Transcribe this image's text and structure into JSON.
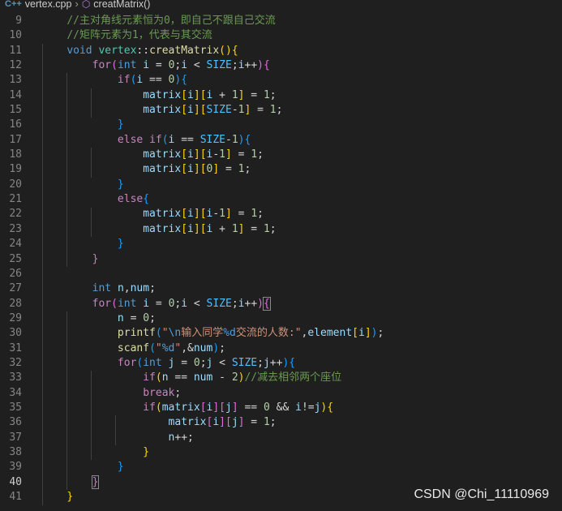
{
  "breadcrumb": {
    "file_icon": "C++",
    "file": "vertex.cpp",
    "separator": "›",
    "method_icon": "⬡",
    "method": "creatMatrix()"
  },
  "watermark": "CSDN @Chi_11110969",
  "colors": {
    "background": "#1f1f1f",
    "comment": "#6a9955",
    "keyword": "#569cd6",
    "control": "#c586c0",
    "function": "#dcdcaa",
    "type": "#4ec9b0",
    "variable": "#9cdcfe",
    "constant": "#4fc1ff",
    "number": "#b5cea8",
    "string": "#ce9178",
    "bracket1": "#ffd700",
    "bracket2": "#da70d6",
    "bracket3": "#179fff"
  },
  "lines": [
    {
      "n": "9",
      "tokens": [
        [
          "    ",
          ""
        ],
        [
          "//主对角线元素恒为0，即自己不跟自己交流",
          "com"
        ]
      ]
    },
    {
      "n": "10",
      "tokens": [
        [
          "    ",
          ""
        ],
        [
          "//矩阵元素为1，代表与其交流",
          "com"
        ]
      ]
    },
    {
      "n": "11",
      "tokens": [
        [
          "    ",
          ""
        ],
        [
          "void",
          "kw"
        ],
        [
          " ",
          ""
        ],
        [
          "vertex",
          "ty"
        ],
        [
          "::",
          "op"
        ],
        [
          "creatMatrix",
          "fn"
        ],
        [
          "(",
          "p1"
        ],
        [
          ")",
          "p1"
        ],
        [
          "{",
          "p1"
        ]
      ]
    },
    {
      "n": "12",
      "tokens": [
        [
          "        ",
          ""
        ],
        [
          "for",
          "ctl"
        ],
        [
          "(",
          "p2"
        ],
        [
          "int",
          "kw"
        ],
        [
          " ",
          ""
        ],
        [
          "i",
          "var"
        ],
        [
          " = ",
          "op"
        ],
        [
          "0",
          "num"
        ],
        [
          ";",
          "op"
        ],
        [
          "i",
          "var"
        ],
        [
          " < ",
          "op"
        ],
        [
          "SIZE",
          "con"
        ],
        [
          ";",
          "op"
        ],
        [
          "i",
          "var"
        ],
        [
          "++",
          "op"
        ],
        [
          ")",
          "p2"
        ],
        [
          "{",
          "p2"
        ]
      ]
    },
    {
      "n": "13",
      "tokens": [
        [
          "            ",
          ""
        ],
        [
          "if",
          "ctl"
        ],
        [
          "(",
          "p3"
        ],
        [
          "i",
          "var"
        ],
        [
          " == ",
          "op"
        ],
        [
          "0",
          "num"
        ],
        [
          ")",
          "p3"
        ],
        [
          "{",
          "p3"
        ]
      ]
    },
    {
      "n": "14",
      "tokens": [
        [
          "                ",
          ""
        ],
        [
          "matrix",
          "var"
        ],
        [
          "[",
          "p1"
        ],
        [
          "i",
          "var"
        ],
        [
          "]",
          "p1"
        ],
        [
          "[",
          "p1"
        ],
        [
          "i",
          "var"
        ],
        [
          " + ",
          "op"
        ],
        [
          "1",
          "num"
        ],
        [
          "]",
          "p1"
        ],
        [
          " = ",
          "op"
        ],
        [
          "1",
          "num"
        ],
        [
          ";",
          "op"
        ]
      ]
    },
    {
      "n": "15",
      "tokens": [
        [
          "                ",
          ""
        ],
        [
          "matrix",
          "var"
        ],
        [
          "[",
          "p1"
        ],
        [
          "i",
          "var"
        ],
        [
          "]",
          "p1"
        ],
        [
          "[",
          "p1"
        ],
        [
          "SIZE",
          "con"
        ],
        [
          "-",
          "op"
        ],
        [
          "1",
          "num"
        ],
        [
          "]",
          "p1"
        ],
        [
          " = ",
          "op"
        ],
        [
          "1",
          "num"
        ],
        [
          ";",
          "op"
        ]
      ]
    },
    {
      "n": "16",
      "tokens": [
        [
          "            ",
          ""
        ],
        [
          "}",
          "p3"
        ]
      ]
    },
    {
      "n": "17",
      "tokens": [
        [
          "            ",
          ""
        ],
        [
          "else",
          "ctl"
        ],
        [
          " ",
          ""
        ],
        [
          "if",
          "ctl"
        ],
        [
          "(",
          "p3"
        ],
        [
          "i",
          "var"
        ],
        [
          " == ",
          "op"
        ],
        [
          "SIZE",
          "con"
        ],
        [
          "-",
          "op"
        ],
        [
          "1",
          "num"
        ],
        [
          ")",
          "p3"
        ],
        [
          "{",
          "p3"
        ]
      ]
    },
    {
      "n": "18",
      "tokens": [
        [
          "                ",
          ""
        ],
        [
          "matrix",
          "var"
        ],
        [
          "[",
          "p1"
        ],
        [
          "i",
          "var"
        ],
        [
          "]",
          "p1"
        ],
        [
          "[",
          "p1"
        ],
        [
          "i",
          "var"
        ],
        [
          "-",
          "op"
        ],
        [
          "1",
          "num"
        ],
        [
          "]",
          "p1"
        ],
        [
          " = ",
          "op"
        ],
        [
          "1",
          "num"
        ],
        [
          ";",
          "op"
        ]
      ]
    },
    {
      "n": "19",
      "tokens": [
        [
          "                ",
          ""
        ],
        [
          "matrix",
          "var"
        ],
        [
          "[",
          "p1"
        ],
        [
          "i",
          "var"
        ],
        [
          "]",
          "p1"
        ],
        [
          "[",
          "p1"
        ],
        [
          "0",
          "num"
        ],
        [
          "]",
          "p1"
        ],
        [
          " = ",
          "op"
        ],
        [
          "1",
          "num"
        ],
        [
          ";",
          "op"
        ]
      ]
    },
    {
      "n": "20",
      "tokens": [
        [
          "            ",
          ""
        ],
        [
          "}",
          "p3"
        ]
      ]
    },
    {
      "n": "21",
      "tokens": [
        [
          "            ",
          ""
        ],
        [
          "else",
          "ctl"
        ],
        [
          "{",
          "p3"
        ]
      ]
    },
    {
      "n": "22",
      "tokens": [
        [
          "                ",
          ""
        ],
        [
          "matrix",
          "var"
        ],
        [
          "[",
          "p1"
        ],
        [
          "i",
          "var"
        ],
        [
          "]",
          "p1"
        ],
        [
          "[",
          "p1"
        ],
        [
          "i",
          "var"
        ],
        [
          "-",
          "op"
        ],
        [
          "1",
          "num"
        ],
        [
          "]",
          "p1"
        ],
        [
          " = ",
          "op"
        ],
        [
          "1",
          "num"
        ],
        [
          ";",
          "op"
        ]
      ]
    },
    {
      "n": "23",
      "tokens": [
        [
          "                ",
          ""
        ],
        [
          "matrix",
          "var"
        ],
        [
          "[",
          "p1"
        ],
        [
          "i",
          "var"
        ],
        [
          "]",
          "p1"
        ],
        [
          "[",
          "p1"
        ],
        [
          "i",
          "var"
        ],
        [
          " + ",
          "op"
        ],
        [
          "1",
          "num"
        ],
        [
          "]",
          "p1"
        ],
        [
          " = ",
          "op"
        ],
        [
          "1",
          "num"
        ],
        [
          ";",
          "op"
        ]
      ]
    },
    {
      "n": "24",
      "tokens": [
        [
          "            ",
          ""
        ],
        [
          "}",
          "p3"
        ]
      ]
    },
    {
      "n": "25",
      "tokens": [
        [
          "        ",
          ""
        ],
        [
          "}",
          "p2"
        ]
      ]
    },
    {
      "n": "26",
      "tokens": []
    },
    {
      "n": "27",
      "tokens": [
        [
          "        ",
          ""
        ],
        [
          "int",
          "kw"
        ],
        [
          " ",
          ""
        ],
        [
          "n",
          "var"
        ],
        [
          ",",
          "op"
        ],
        [
          "num",
          "var"
        ],
        [
          ";",
          "op"
        ]
      ]
    },
    {
      "n": "28",
      "tokens": [
        [
          "        ",
          ""
        ],
        [
          "for",
          "ctl"
        ],
        [
          "(",
          "p2"
        ],
        [
          "int",
          "kw"
        ],
        [
          " ",
          ""
        ],
        [
          "i",
          "var"
        ],
        [
          " = ",
          "op"
        ],
        [
          "0",
          "num"
        ],
        [
          ";",
          "op"
        ],
        [
          "i",
          "var"
        ],
        [
          " < ",
          "op"
        ],
        [
          "SIZE",
          "con"
        ],
        [
          ";",
          "op"
        ],
        [
          "i",
          "var"
        ],
        [
          "++",
          "op"
        ],
        [
          ")",
          "p2"
        ],
        [
          "{",
          "p2 box"
        ]
      ]
    },
    {
      "n": "29",
      "tokens": [
        [
          "            ",
          ""
        ],
        [
          "n",
          "var"
        ],
        [
          " = ",
          "op"
        ],
        [
          "0",
          "num"
        ],
        [
          ";",
          "op"
        ]
      ]
    },
    {
      "n": "30",
      "tokens": [
        [
          "            ",
          ""
        ],
        [
          "printf",
          "fn"
        ],
        [
          "(",
          "p3"
        ],
        [
          "\"",
          "str"
        ],
        [
          "\\n",
          "fmt"
        ],
        [
          "输入同学",
          "str"
        ],
        [
          "%d",
          "fmt"
        ],
        [
          "交流的人数:\"",
          "str"
        ],
        [
          ",",
          "op"
        ],
        [
          "element",
          "var"
        ],
        [
          "[",
          "p1"
        ],
        [
          "i",
          "var"
        ],
        [
          "]",
          "p1"
        ],
        [
          ")",
          "p3"
        ],
        [
          ";",
          "op"
        ]
      ]
    },
    {
      "n": "31",
      "tokens": [
        [
          "            ",
          ""
        ],
        [
          "scanf",
          "fn"
        ],
        [
          "(",
          "p3"
        ],
        [
          "\"",
          "str"
        ],
        [
          "%d",
          "fmt"
        ],
        [
          "\"",
          "str"
        ],
        [
          ",",
          "op"
        ],
        [
          "&",
          "op"
        ],
        [
          "num",
          "var"
        ],
        [
          ")",
          "p3"
        ],
        [
          ";",
          "op"
        ]
      ]
    },
    {
      "n": "32",
      "tokens": [
        [
          "            ",
          ""
        ],
        [
          "for",
          "ctl"
        ],
        [
          "(",
          "p3"
        ],
        [
          "int",
          "kw"
        ],
        [
          " ",
          ""
        ],
        [
          "j",
          "var"
        ],
        [
          " = ",
          "op"
        ],
        [
          "0",
          "num"
        ],
        [
          ";",
          "op"
        ],
        [
          "j",
          "var"
        ],
        [
          " < ",
          "op"
        ],
        [
          "SIZE",
          "con"
        ],
        [
          ";",
          "op"
        ],
        [
          "j",
          "var"
        ],
        [
          "++",
          "op"
        ],
        [
          ")",
          "p3"
        ],
        [
          "{",
          "p3"
        ]
      ]
    },
    {
      "n": "33",
      "tokens": [
        [
          "                ",
          ""
        ],
        [
          "if",
          "ctl"
        ],
        [
          "(",
          "p1"
        ],
        [
          "n",
          "var"
        ],
        [
          " == ",
          "op"
        ],
        [
          "num",
          "var"
        ],
        [
          " - ",
          "op"
        ],
        [
          "2",
          "num"
        ],
        [
          ")",
          "p1"
        ],
        [
          "//减去相邻两个座位",
          "com"
        ]
      ]
    },
    {
      "n": "34",
      "tokens": [
        [
          "                ",
          ""
        ],
        [
          "break",
          "ctl"
        ],
        [
          ";",
          "op"
        ]
      ]
    },
    {
      "n": "35",
      "tokens": [
        [
          "                ",
          ""
        ],
        [
          "if",
          "ctl"
        ],
        [
          "(",
          "p1"
        ],
        [
          "matrix",
          "var"
        ],
        [
          "[",
          "p2"
        ],
        [
          "i",
          "var"
        ],
        [
          "]",
          "p2"
        ],
        [
          "[",
          "p2"
        ],
        [
          "j",
          "var"
        ],
        [
          "]",
          "p2"
        ],
        [
          " == ",
          "op"
        ],
        [
          "0",
          "num"
        ],
        [
          " && ",
          "op"
        ],
        [
          "i",
          "var"
        ],
        [
          "!=",
          "op"
        ],
        [
          "j",
          "var"
        ],
        [
          ")",
          "p1"
        ],
        [
          "{",
          "p1"
        ]
      ]
    },
    {
      "n": "36",
      "tokens": [
        [
          "                    ",
          ""
        ],
        [
          "matrix",
          "var"
        ],
        [
          "[",
          "p2"
        ],
        [
          "i",
          "var"
        ],
        [
          "]",
          "p2"
        ],
        [
          "[",
          "p2"
        ],
        [
          "j",
          "var"
        ],
        [
          "]",
          "p2"
        ],
        [
          " = ",
          "op"
        ],
        [
          "1",
          "num"
        ],
        [
          ";",
          "op"
        ]
      ]
    },
    {
      "n": "37",
      "tokens": [
        [
          "                    ",
          ""
        ],
        [
          "n",
          "var"
        ],
        [
          "++",
          "op"
        ],
        [
          ";",
          "op"
        ]
      ]
    },
    {
      "n": "38",
      "tokens": [
        [
          "                ",
          ""
        ],
        [
          "}",
          "p1"
        ]
      ]
    },
    {
      "n": "39",
      "tokens": [
        [
          "            ",
          ""
        ],
        [
          "}",
          "p3"
        ]
      ]
    },
    {
      "n": "40",
      "current": true,
      "tokens": [
        [
          "        ",
          ""
        ],
        [
          "}",
          "p2 box"
        ]
      ]
    },
    {
      "n": "41",
      "tokens": [
        [
          "    ",
          ""
        ],
        [
          "}",
          "p1"
        ]
      ]
    }
  ]
}
